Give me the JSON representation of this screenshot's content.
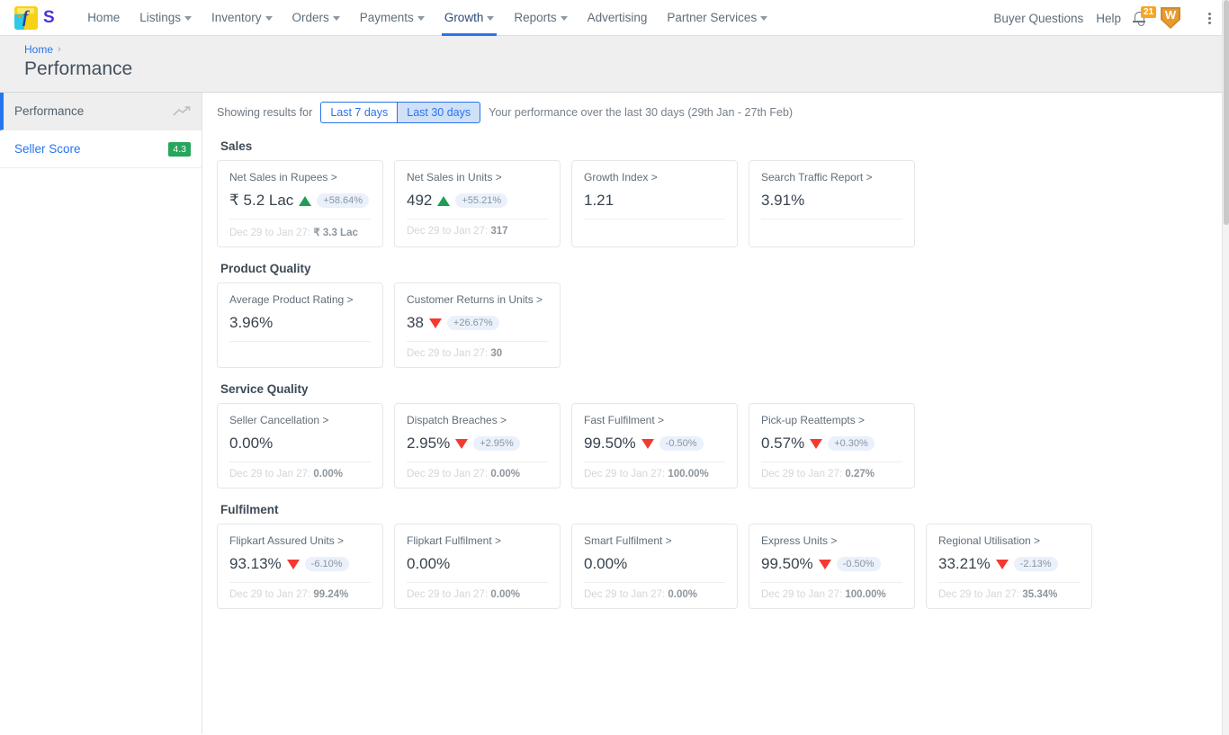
{
  "topnav": {
    "brand": {
      "logo_icon": "flipkart-logo-icon",
      "seller_mark": "S"
    },
    "links": [
      {
        "label": "Home",
        "has_caret": false,
        "active": false
      },
      {
        "label": "Listings",
        "has_caret": true,
        "active": false
      },
      {
        "label": "Inventory",
        "has_caret": true,
        "active": false
      },
      {
        "label": "Orders",
        "has_caret": true,
        "active": false
      },
      {
        "label": "Payments",
        "has_caret": true,
        "active": false
      },
      {
        "label": "Growth",
        "has_caret": true,
        "active": true
      },
      {
        "label": "Reports",
        "has_caret": true,
        "active": false
      },
      {
        "label": "Advertising",
        "has_caret": false,
        "active": false
      },
      {
        "label": "Partner Services",
        "has_caret": true,
        "active": false
      }
    ],
    "right": {
      "buyer_questions": "Buyer Questions",
      "help": "Help",
      "notification_count": "21",
      "shield_letter": "W"
    }
  },
  "pagehead": {
    "breadcrumb_home": "Home",
    "breadcrumb_sep": "›",
    "title": "Performance"
  },
  "sidebar": {
    "items": [
      {
        "label": "Performance",
        "badge": "",
        "active": true
      },
      {
        "label": "Seller Score",
        "badge": "4.3",
        "active": false
      }
    ]
  },
  "filters": {
    "showing_label": "Showing results for",
    "options": [
      {
        "label": "Last 7 days",
        "selected": false
      },
      {
        "label": "Last 30 days",
        "selected": true
      }
    ],
    "description": "Your performance over the last 30 days (29th Jan - 27th Feb)"
  },
  "colors": {
    "accent_blue": "#2874f0",
    "up_green": "#1f9d55",
    "down_red": "#f4392f",
    "badge_green": "#26a65b",
    "badge_orange": "#f5a623"
  },
  "sections": [
    {
      "title": "Sales",
      "cards": [
        {
          "title": "Net Sales in Rupees >",
          "value": "₹ 5.2 Lac",
          "trend": "up",
          "delta": "+58.64%",
          "prev_label": "Dec 29 to Jan 27:",
          "prev_value": "₹ 3.3 Lac"
        },
        {
          "title": "Net Sales in Units >",
          "value": "492",
          "trend": "up",
          "delta": "+55.21%",
          "prev_label": "Dec 29 to Jan 27:",
          "prev_value": "317"
        },
        {
          "title": "Growth Index >",
          "value": "1.21",
          "trend": "none",
          "delta": "",
          "prev_label": "",
          "prev_value": ""
        },
        {
          "title": "Search Traffic Report >",
          "value": "3.91%",
          "trend": "none",
          "delta": "",
          "prev_label": "",
          "prev_value": ""
        }
      ]
    },
    {
      "title": "Product Quality",
      "cards": [
        {
          "title": "Average Product Rating >",
          "value": "3.96%",
          "trend": "none",
          "delta": "",
          "prev_label": "",
          "prev_value": ""
        },
        {
          "title": "Customer Returns in Units >",
          "value": "38",
          "trend": "down",
          "delta": "+26.67%",
          "prev_label": "Dec 29 to Jan 27:",
          "prev_value": "30"
        }
      ]
    },
    {
      "title": "Service Quality",
      "cards": [
        {
          "title": "Seller Cancellation >",
          "value": "0.00%",
          "trend": "none",
          "delta": "",
          "prev_label": "Dec 29 to Jan 27:",
          "prev_value": "0.00%"
        },
        {
          "title": "Dispatch Breaches >",
          "value": "2.95%",
          "trend": "down",
          "delta": "+2.95%",
          "prev_label": "Dec 29 to Jan 27:",
          "prev_value": "0.00%"
        },
        {
          "title": "Fast Fulfilment >",
          "value": "99.50%",
          "trend": "down",
          "delta": "-0.50%",
          "prev_label": "Dec 29 to Jan 27:",
          "prev_value": "100.00%"
        },
        {
          "title": "Pick-up Reattempts >",
          "value": "0.57%",
          "trend": "down",
          "delta": "+0.30%",
          "prev_label": "Dec 29 to Jan 27:",
          "prev_value": "0.27%"
        }
      ]
    },
    {
      "title": "Fulfilment",
      "cards": [
        {
          "title": "Flipkart Assured Units >",
          "value": "93.13%",
          "trend": "down",
          "delta": "-6.10%",
          "prev_label": "Dec 29 to Jan 27:",
          "prev_value": "99.24%"
        },
        {
          "title": "Flipkart Fulfilment >",
          "value": "0.00%",
          "trend": "none",
          "delta": "",
          "prev_label": "Dec 29 to Jan 27:",
          "prev_value": "0.00%"
        },
        {
          "title": "Smart Fulfilment >",
          "value": "0.00%",
          "trend": "none",
          "delta": "",
          "prev_label": "Dec 29 to Jan 27:",
          "prev_value": "0.00%"
        },
        {
          "title": "Express Units >",
          "value": "99.50%",
          "trend": "down",
          "delta": "-0.50%",
          "prev_label": "Dec 29 to Jan 27:",
          "prev_value": "100.00%"
        },
        {
          "title": "Regional Utilisation >",
          "value": "33.21%",
          "trend": "down",
          "delta": "-2.13%",
          "prev_label": "Dec 29 to Jan 27:",
          "prev_value": "35.34%"
        }
      ]
    }
  ]
}
